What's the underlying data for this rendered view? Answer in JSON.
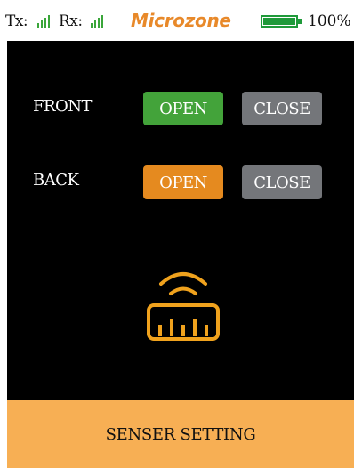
{
  "status_bar": {
    "tx_label": "Tx:",
    "rx_label": "Rx:",
    "brand": "Microzone",
    "battery_level": 1.0,
    "battery_text": "100%",
    "colors": {
      "signal": "#3aa63a",
      "brand": "#e8892a",
      "battery": "#1f9a3a"
    }
  },
  "rows": [
    {
      "label": "FRONT",
      "open_label": "OPEN",
      "close_label": "CLOSE",
      "selected": "open",
      "selected_color": "#43a33a"
    },
    {
      "label": "BACK",
      "open_label": "OPEN",
      "close_label": "CLOSE",
      "selected": "open",
      "selected_color": "#e58a1f"
    }
  ],
  "sensor_icon": {
    "name": "sensor-ruler-icon",
    "color": "#f0a21d"
  },
  "footer": {
    "label": "SENSER SETTING",
    "color": "#f7af54"
  }
}
